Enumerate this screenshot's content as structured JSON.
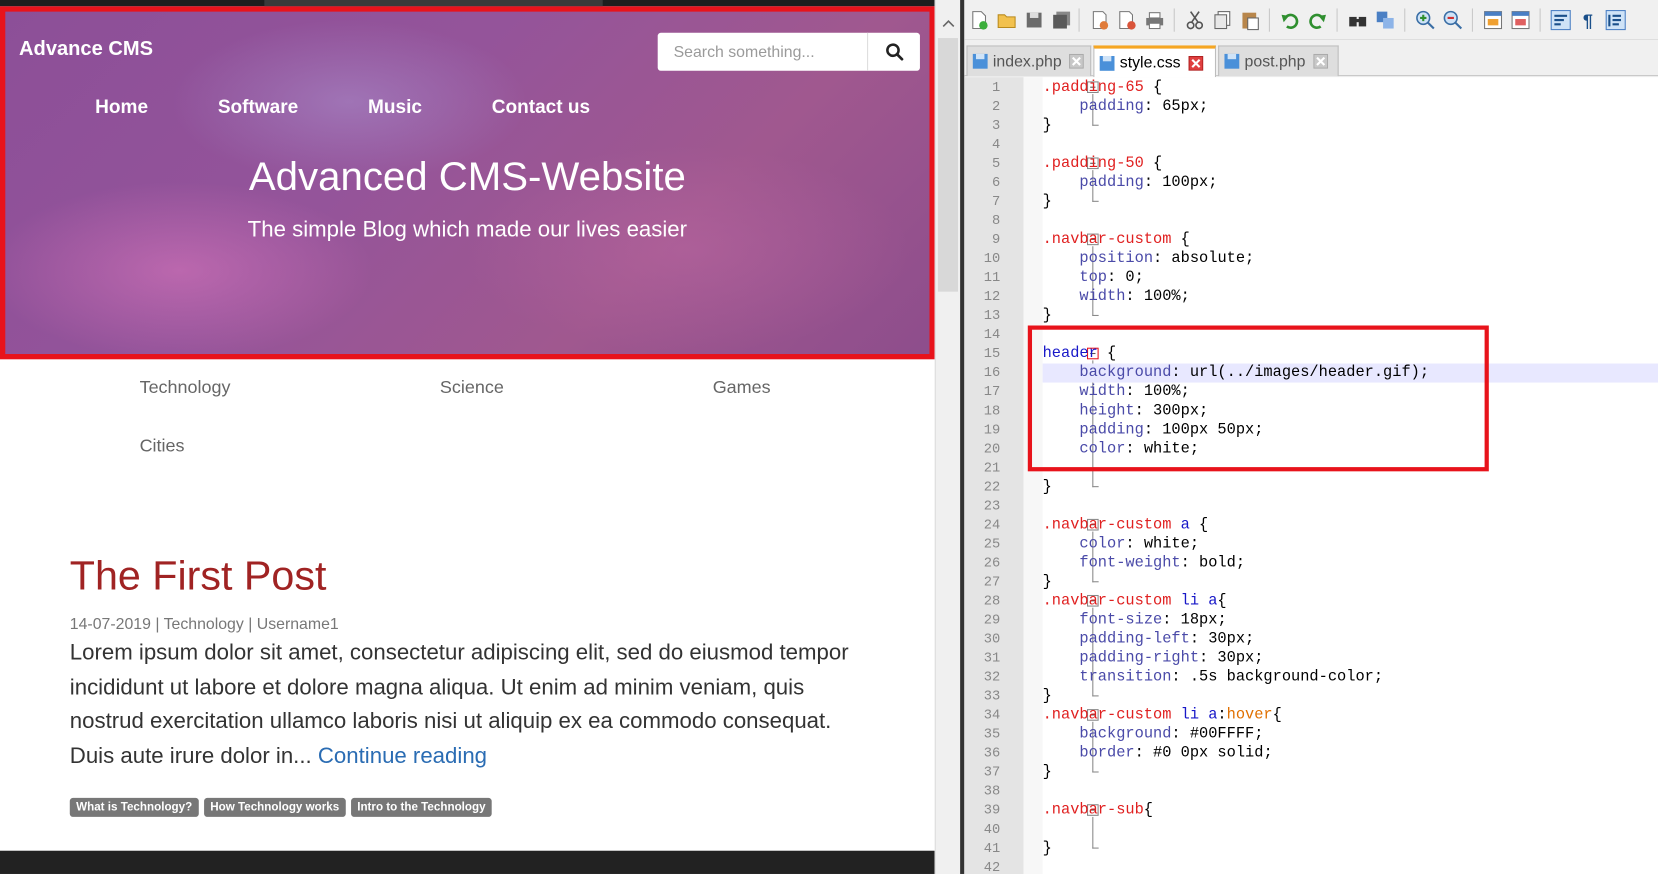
{
  "site": {
    "brand": "Advance CMS",
    "search": {
      "placeholder": "Search something..."
    },
    "nav": [
      "Home",
      "Software",
      "Music",
      "Contact us"
    ],
    "hero_title": "Advanced CMS-Website",
    "hero_subtitle": "The simple Blog which made our lives easier",
    "categories": [
      "Technology",
      "Science",
      "Games",
      "Cities"
    ],
    "post": {
      "title": "The First Post",
      "meta": "14-07-2019 | Technology | Username1",
      "excerpt": "Lorem ipsum dolor sit amet, consectetur adipiscing elit, sed do eiusmod tempor incididunt ut labore et dolore magna aliqua. Ut enim ad minim veniam, quis nostrud exercitation ullamco laboris nisi ut aliquip ex ea commodo consequat. Duis aute irure dolor in...",
      "continue": "Continue reading",
      "tags": [
        "What is Technology?",
        "How Technology works",
        "Intro to the Technology"
      ]
    }
  },
  "editor": {
    "tabs": [
      {
        "name": "index.php",
        "active": false
      },
      {
        "name": "style.css",
        "active": true
      },
      {
        "name": "post.php",
        "active": false
      }
    ],
    "highlight_color": "#e8131b",
    "lines": [
      [
        [
          "sel",
          ".padding-65"
        ],
        [
          "pun",
          " {"
        ]
      ],
      [
        [
          "pun",
          "    "
        ],
        [
          "prop",
          "padding"
        ],
        [
          "pun",
          ": "
        ],
        [
          "val",
          "65px"
        ],
        [
          "pun",
          ";"
        ]
      ],
      [
        [
          "pun",
          "}"
        ]
      ],
      [],
      [
        [
          "sel",
          ".padding-50"
        ],
        [
          "pun",
          " {"
        ]
      ],
      [
        [
          "pun",
          "    "
        ],
        [
          "prop",
          "padding"
        ],
        [
          "pun",
          ": "
        ],
        [
          "val",
          "100px"
        ],
        [
          "pun",
          ";"
        ]
      ],
      [
        [
          "pun",
          "}"
        ]
      ],
      [],
      [
        [
          "sel",
          ".navbar-custom"
        ],
        [
          "pun",
          " {"
        ]
      ],
      [
        [
          "pun",
          "    "
        ],
        [
          "prop",
          "position"
        ],
        [
          "pun",
          ": "
        ],
        [
          "val",
          "absolute"
        ],
        [
          "pun",
          ";"
        ]
      ],
      [
        [
          "pun",
          "    "
        ],
        [
          "prop",
          "top"
        ],
        [
          "pun",
          ": "
        ],
        [
          "val",
          "0"
        ],
        [
          "pun",
          ";"
        ]
      ],
      [
        [
          "pun",
          "    "
        ],
        [
          "prop",
          "width"
        ],
        [
          "pun",
          ": "
        ],
        [
          "val",
          "100%"
        ],
        [
          "pun",
          ";"
        ]
      ],
      [
        [
          "pun",
          "}"
        ]
      ],
      [],
      [
        [
          "tagsel",
          "header"
        ],
        [
          "pun",
          " {"
        ]
      ],
      [
        [
          "pun",
          "    "
        ],
        [
          "prop",
          "background"
        ],
        [
          "pun",
          ": "
        ],
        [
          "val",
          "url(../images/header.gif)"
        ],
        [
          "pun",
          ";"
        ]
      ],
      [
        [
          "pun",
          "    "
        ],
        [
          "prop",
          "width"
        ],
        [
          "pun",
          ": "
        ],
        [
          "val",
          "100%"
        ],
        [
          "pun",
          ";"
        ]
      ],
      [
        [
          "pun",
          "    "
        ],
        [
          "prop",
          "height"
        ],
        [
          "pun",
          ": "
        ],
        [
          "val",
          "300px"
        ],
        [
          "pun",
          ";"
        ]
      ],
      [
        [
          "pun",
          "    "
        ],
        [
          "prop",
          "padding"
        ],
        [
          "pun",
          ": "
        ],
        [
          "val",
          "100px 50px"
        ],
        [
          "pun",
          ";"
        ]
      ],
      [
        [
          "pun",
          "    "
        ],
        [
          "prop",
          "color"
        ],
        [
          "pun",
          ": "
        ],
        [
          "val",
          "white"
        ],
        [
          "pun",
          ";"
        ]
      ],
      [],
      [
        [
          "pun",
          "}"
        ]
      ],
      [],
      [
        [
          "sel",
          ".navbar-custom"
        ],
        [
          "pun",
          " "
        ],
        [
          "tagsel",
          "a"
        ],
        [
          "pun",
          " {"
        ]
      ],
      [
        [
          "pun",
          "    "
        ],
        [
          "prop",
          "color"
        ],
        [
          "pun",
          ": "
        ],
        [
          "val",
          "white"
        ],
        [
          "pun",
          ";"
        ]
      ],
      [
        [
          "pun",
          "    "
        ],
        [
          "prop",
          "font-weight"
        ],
        [
          "pun",
          ": "
        ],
        [
          "val",
          "bold"
        ],
        [
          "pun",
          ";"
        ]
      ],
      [
        [
          "pun",
          "}"
        ]
      ],
      [
        [
          "sel",
          ".navbar-custom"
        ],
        [
          "pun",
          " "
        ],
        [
          "tagsel",
          "li a"
        ],
        [
          "pun",
          "{"
        ]
      ],
      [
        [
          "pun",
          "    "
        ],
        [
          "prop",
          "font-size"
        ],
        [
          "pun",
          ": "
        ],
        [
          "val",
          "18px"
        ],
        [
          "pun",
          ";"
        ]
      ],
      [
        [
          "pun",
          "    "
        ],
        [
          "prop",
          "padding-left"
        ],
        [
          "pun",
          ": "
        ],
        [
          "val",
          "30px"
        ],
        [
          "pun",
          ";"
        ]
      ],
      [
        [
          "pun",
          "    "
        ],
        [
          "prop",
          "padding-right"
        ],
        [
          "pun",
          ": "
        ],
        [
          "val",
          "30px"
        ],
        [
          "pun",
          ";"
        ]
      ],
      [
        [
          "pun",
          "    "
        ],
        [
          "prop",
          "transition"
        ],
        [
          "pun",
          ": "
        ],
        [
          "val",
          ".5s background-color"
        ],
        [
          "pun",
          ";"
        ]
      ],
      [
        [
          "pun",
          "}"
        ]
      ],
      [
        [
          "sel",
          ".navbar-custom"
        ],
        [
          "pun",
          " "
        ],
        [
          "tagsel",
          "li a"
        ],
        [
          "pun",
          ":"
        ],
        [
          "pseudo",
          "hover"
        ],
        [
          "pun",
          "{"
        ]
      ],
      [
        [
          "pun",
          "    "
        ],
        [
          "prop",
          "background"
        ],
        [
          "pun",
          ": "
        ],
        [
          "val",
          "#00FFFF"
        ],
        [
          "pun",
          ";"
        ]
      ],
      [
        [
          "pun",
          "    "
        ],
        [
          "prop",
          "border"
        ],
        [
          "pun",
          ": "
        ],
        [
          "val",
          "#0 0px solid"
        ],
        [
          "pun",
          ";"
        ]
      ],
      [
        [
          "pun",
          "}"
        ]
      ],
      [],
      [
        [
          "sel",
          ".navbar-sub"
        ],
        [
          "pun",
          "{"
        ]
      ],
      [],
      [
        [
          "pun",
          "}"
        ]
      ],
      []
    ]
  }
}
